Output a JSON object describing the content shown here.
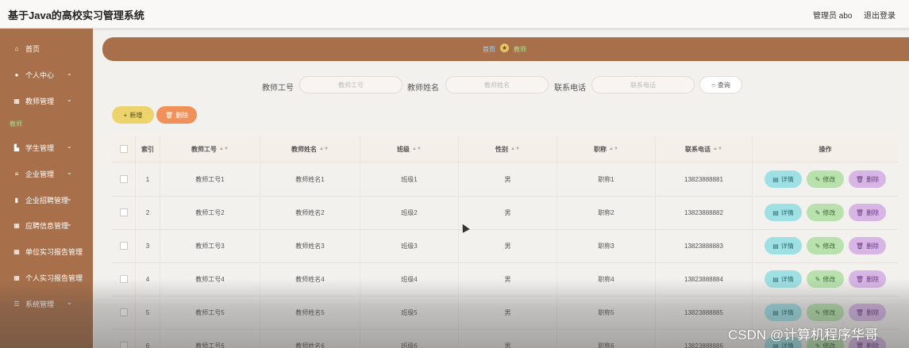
{
  "header": {
    "title": "基于Java的高校实习管理系统",
    "admin": "管理员 abo",
    "logout": "退出登录"
  },
  "sidebar": {
    "items": [
      {
        "label": "首页",
        "icon": "home-icon",
        "glyph": "⌂",
        "chevron": ""
      },
      {
        "label": "个人中心",
        "icon": "person-icon",
        "glyph": "●",
        "chevron": "⌄"
      },
      {
        "label": "教师管理",
        "icon": "grid-icon",
        "glyph": "▦",
        "chevron": "⌄"
      },
      {
        "label": "学生管理",
        "icon": "student-icon",
        "glyph": "▙",
        "chevron": "⌄"
      },
      {
        "label": "企业管理",
        "icon": "list-icon",
        "glyph": "≡",
        "chevron": "⌄"
      },
      {
        "label": "企业招聘管理",
        "icon": "chart-icon",
        "glyph": "▮",
        "chevron": "⌄"
      },
      {
        "label": "应聘信息管理",
        "icon": "grid-icon",
        "glyph": "▦",
        "chevron": "⌄"
      },
      {
        "label": "单位实习报告管理",
        "icon": "grid-icon",
        "glyph": "▦",
        "chevron": ""
      },
      {
        "label": "个人实习报告管理",
        "icon": "grid-icon",
        "glyph": "▦",
        "chevron": ""
      },
      {
        "label": "系统管理",
        "icon": "settings-icon",
        "glyph": "☰",
        "chevron": "⌄"
      }
    ],
    "sub_item": "教师"
  },
  "breadcrumb": {
    "home": "首页",
    "current": "教师"
  },
  "search": {
    "fields": [
      {
        "label": "教师工号",
        "placeholder": "教师工号"
      },
      {
        "label": "教师姓名",
        "placeholder": "教师姓名"
      },
      {
        "label": "联系电话",
        "placeholder": "联系电话"
      }
    ],
    "query_label": "查询"
  },
  "actions": {
    "add": "新增",
    "delete": "删除"
  },
  "table": {
    "headers": [
      "索引",
      "教师工号",
      "教师姓名",
      "班级",
      "性别",
      "职称",
      "联系电话",
      "操作"
    ],
    "row_actions": {
      "detail": "详情",
      "edit": "修改",
      "delete": "删除"
    },
    "rows": [
      [
        "1",
        "教师工号1",
        "教师姓名1",
        "班级1",
        "男",
        "职称1",
        "13823888881"
      ],
      [
        "2",
        "教师工号2",
        "教师姓名2",
        "班级2",
        "男",
        "职称2",
        "13823888882"
      ],
      [
        "3",
        "教师工号3",
        "教师姓名3",
        "班级3",
        "男",
        "职称3",
        "13823888883"
      ],
      [
        "4",
        "教师工号4",
        "教师姓名4",
        "班级4",
        "男",
        "职称4",
        "13823888884"
      ],
      [
        "5",
        "教师工号5",
        "教师姓名5",
        "班级5",
        "男",
        "职称5",
        "13823888885"
      ],
      [
        "6",
        "教师工号6",
        "教师姓名6",
        "班级6",
        "男",
        "职称6",
        "13823888886"
      ]
    ]
  },
  "watermark": "CSDN @计算机程序华哥",
  "colors": {
    "accent": "#a8704a",
    "detail": "#9fe0e5",
    "edit": "#b8e1ae",
    "delete": "#d7b6e6",
    "add": "#ecd36c",
    "remove": "#f0915a"
  }
}
